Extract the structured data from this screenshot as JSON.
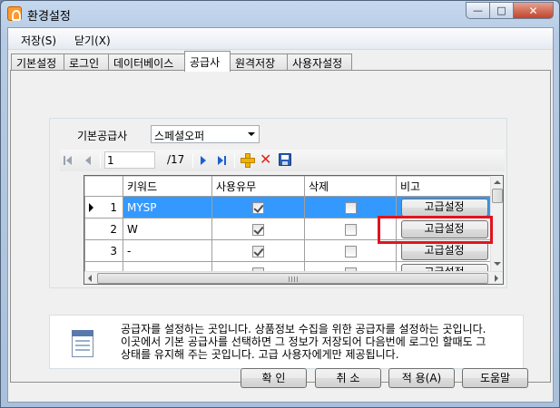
{
  "window": {
    "title": "환경설정",
    "caption": {
      "minimize": "—",
      "maximize": "□",
      "close": "✕"
    }
  },
  "menu": {
    "items": [
      "저장(S)",
      "닫기(X)"
    ]
  },
  "tabs": [
    "기본설정",
    "로그인",
    "데이터베이스",
    "공급사",
    "원격저장",
    "사용자설정"
  ],
  "active_tab": "공급사",
  "supplier": {
    "label": "기본공급사",
    "selected": "스페셜오퍼"
  },
  "navigator": {
    "position": "1",
    "count": "/17"
  },
  "grid": {
    "columns": [
      "키워드",
      "사용유무",
      "삭제",
      "비고"
    ],
    "rows": [
      {
        "num": "1",
        "keyword": "MYSP",
        "use": true,
        "del": false,
        "note": "고급설정",
        "selected": true
      },
      {
        "num": "2",
        "keyword": "W",
        "use": true,
        "del": false,
        "note": "고급설정",
        "selected": false
      },
      {
        "num": "3",
        "keyword": "-",
        "use": true,
        "del": false,
        "note": "고급설정",
        "selected": false
      },
      {
        "num": "",
        "keyword": "",
        "use": false,
        "del": false,
        "note": "고급설정",
        "selected": false
      }
    ]
  },
  "info": {
    "lines": [
      "공급자를 설정하는 곳입니다. 상품정보 수집을 위한 공급자를 설정하는 곳입니다.",
      "이곳에서 기본 공급사를 선택하면 그 정보가 저장되어 다음번에 로그인 할때도 그",
      "상태를 유지해 주는 곳입니다. 고급 사용자에게만 제공됩니다."
    ]
  },
  "buttons": {
    "ok": "확 인",
    "cancel": "취 소",
    "apply": "적 용(A)",
    "help": "도움말"
  }
}
